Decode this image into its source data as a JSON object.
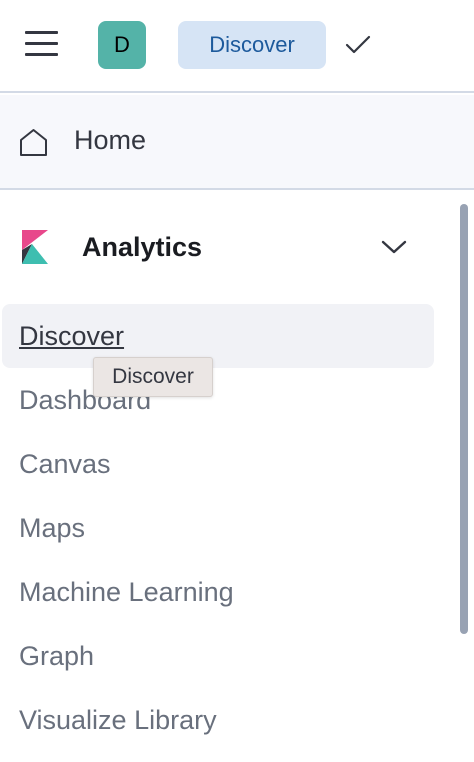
{
  "header": {
    "space_initial": "D",
    "breadcrumb": "Discover"
  },
  "home": {
    "label": "Home"
  },
  "section": {
    "title": "Analytics",
    "items": [
      {
        "label": "Discover"
      },
      {
        "label": "Dashboard"
      },
      {
        "label": "Canvas"
      },
      {
        "label": "Maps"
      },
      {
        "label": "Machine Learning"
      },
      {
        "label": "Graph"
      },
      {
        "label": "Visualize Library"
      }
    ]
  },
  "tooltip": {
    "text": "Discover"
  },
  "icons": {
    "menu": "hamburger-menu-icon",
    "check": "check-icon",
    "home": "home-icon",
    "logo": "kibana-logo-icon",
    "chevron": "chevron-down-icon"
  },
  "colors": {
    "avatar_bg": "#54b3a8",
    "breadcrumb_bg": "#d6e4f5",
    "breadcrumb_text": "#1d5a9c",
    "logo_pink": "#e8488b",
    "logo_teal": "#3ebeb0",
    "logo_dark": "#343741"
  }
}
